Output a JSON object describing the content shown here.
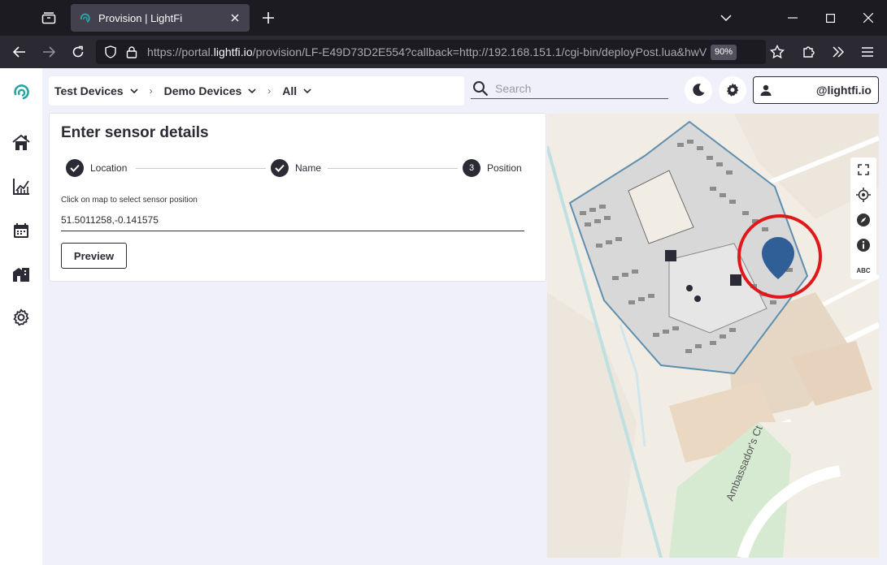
{
  "browser": {
    "tab_title": "Provision | LightFi",
    "url_prefix": "https://portal.",
    "url_domain": "lightfi.io",
    "url_rest": "/provision/LF-E49D73D2E554?callback=http://192.168.151.1/cgi-bin/deployPost.lua&hwV",
    "zoom": "90%"
  },
  "breadcrumb": {
    "items": [
      {
        "label": "Test Devices"
      },
      {
        "label": "Demo Devices"
      },
      {
        "label": "All"
      }
    ],
    "separator": "›"
  },
  "search": {
    "placeholder": "Search"
  },
  "user": {
    "name": "@lightfi.io"
  },
  "form": {
    "title": "Enter sensor details",
    "steps": [
      {
        "label": "Location",
        "status": "done"
      },
      {
        "label": "Name",
        "status": "done"
      },
      {
        "label": "Position",
        "number": "3",
        "status": "active"
      }
    ],
    "position_label": "Click on map to select sensor position",
    "position_value": "51.5011258,-0.141575",
    "preview_label": "Preview"
  },
  "map": {
    "street_label": "Ambassador's Ct",
    "controls": [
      "fullscreen-icon",
      "locate-icon",
      "compass-icon",
      "info-icon",
      "abc-icon"
    ],
    "abc_label": "ABC",
    "marker_color": "#2f5f96",
    "highlight_color": "#e0181c"
  },
  "colors": {
    "accent": "#2aa3a3",
    "dark": "#2b2b36"
  }
}
